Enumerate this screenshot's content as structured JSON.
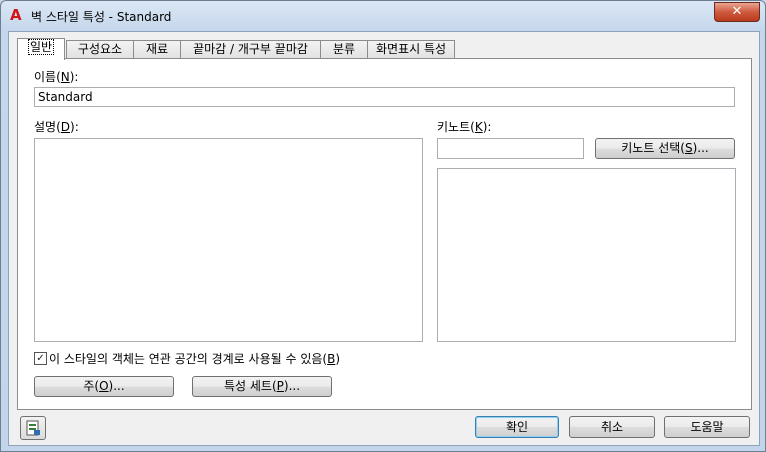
{
  "window": {
    "title": "벽 스타일 특성 - Standard",
    "app_icon_glyph": "A",
    "close_glyph": "✕"
  },
  "tabs": [
    {
      "label": "일반",
      "active": true
    },
    {
      "label": "구성요소"
    },
    {
      "label": "재료"
    },
    {
      "label": "끝마감 / 개구부 끝마감"
    },
    {
      "label": "분류"
    },
    {
      "label": "화면표시 특성"
    }
  ],
  "general": {
    "name_label_prefix": "이름(",
    "name_label_key": "N",
    "name_label_suffix": "):",
    "name_value": "Standard",
    "description_label_prefix": "설명(",
    "description_label_key": "D",
    "description_label_suffix": "):",
    "keynote_label_prefix": "키노트(",
    "keynote_label_key": "K",
    "keynote_label_suffix": "):",
    "keynote_value": "",
    "keynote_select_prefix": "키노트 선택(",
    "keynote_select_key": "S",
    "keynote_select_suffix": ")...",
    "boundary_checkbox_prefix": "이 스타일의 객체는 연관 공간의 경계로 사용될 수 있음(",
    "boundary_checkbox_key": "B",
    "boundary_checkbox_suffix": ")",
    "boundary_checked": true,
    "notes_prefix": "주(",
    "notes_key": "O",
    "notes_suffix": ")...",
    "property_sets_prefix": "특성 세트(",
    "property_sets_key": "P",
    "property_sets_suffix": ")..."
  },
  "footer": {
    "ok_label": "확인",
    "cancel_label": "취소",
    "help_label": "도움말"
  },
  "icons": {
    "app": "autocad-a-icon",
    "details": "style-details-icon"
  }
}
